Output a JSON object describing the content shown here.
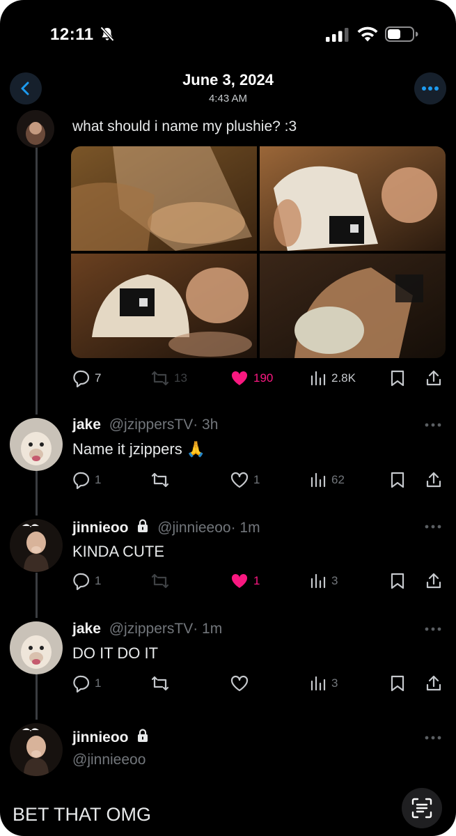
{
  "status_bar": {
    "time": "12:11"
  },
  "header": {
    "title": "June 3, 2024",
    "subtitle": "4:43 AM"
  },
  "main_post": {
    "text": "what should i name my plushie? :3",
    "actions": {
      "replies": "7",
      "reposts": "13",
      "likes": "190",
      "views": "2.8K"
    }
  },
  "replies": [
    {
      "name": "jake",
      "handle": "@jzippersTV",
      "time": "· 3h",
      "locked": false,
      "text": "Name it jzippers 🙏",
      "actions": {
        "replies": "1",
        "likes": "1",
        "views": "62",
        "liked": false
      }
    },
    {
      "name": "jinnieoo",
      "handle": "@jinnieeoo",
      "time": "· 1m",
      "locked": true,
      "text": "KINDA CUTE",
      "actions": {
        "replies": "1",
        "likes": "1",
        "views": "3",
        "liked": true
      }
    },
    {
      "name": "jake",
      "handle": "@jzippersTV",
      "time": "· 1m",
      "locked": false,
      "text": "DO IT DO IT",
      "actions": {
        "replies": "1",
        "likes": "",
        "views": "3",
        "liked": false
      }
    }
  ],
  "focused_reply": {
    "name": "jinnieoo",
    "handle": "@jinnieeoo",
    "locked": true,
    "text": "BET THAT OMG"
  },
  "colors": {
    "like_pink": "#f91880",
    "muted_gray": "#72767b",
    "background": "#000000"
  }
}
